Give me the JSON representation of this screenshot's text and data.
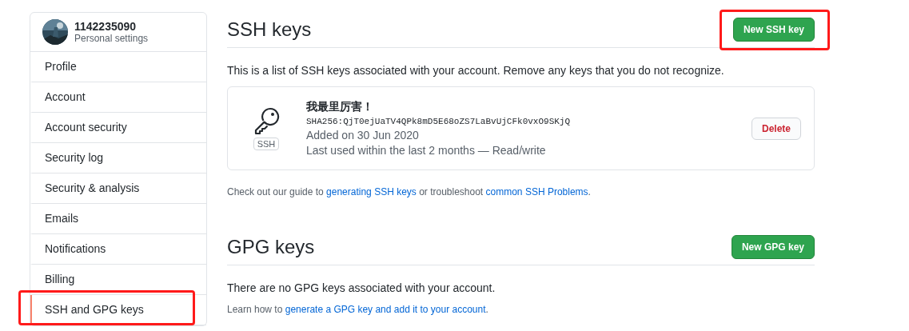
{
  "profile": {
    "username": "1142235090",
    "subtitle": "Personal settings"
  },
  "sidebar": {
    "items": [
      {
        "label": "Profile",
        "selected": false,
        "highlighted": false
      },
      {
        "label": "Account",
        "selected": false,
        "highlighted": false
      },
      {
        "label": "Account security",
        "selected": false,
        "highlighted": false
      },
      {
        "label": "Security log",
        "selected": false,
        "highlighted": false
      },
      {
        "label": "Security & analysis",
        "selected": false,
        "highlighted": false
      },
      {
        "label": "Emails",
        "selected": false,
        "highlighted": false
      },
      {
        "label": "Notifications",
        "selected": false,
        "highlighted": false
      },
      {
        "label": "Billing",
        "selected": false,
        "highlighted": false
      },
      {
        "label": "SSH and GPG keys",
        "selected": true,
        "highlighted": true
      }
    ]
  },
  "sections": [
    {
      "title": "SSH keys",
      "button": {
        "label": "New SSH key",
        "highlighted": true
      },
      "description": "This is a list of SSH keys associated with your account. Remove any keys that you do not recognize.",
      "keys": [
        {
          "name": "我最里厉害！",
          "fingerprint": "SHA256:QjT0ejUaTV4QPk8mD5E68oZS7LaBvUjCFk0vxO9SKjQ",
          "added": "Added on 30 Jun 2020",
          "last_used": "Last used within the last 2 months — Read/write",
          "badge": "SSH",
          "action": "Delete"
        }
      ],
      "footer": [
        {
          "text": "Check out our guide to ",
          "link": false
        },
        {
          "text": "generating SSH keys",
          "link": true
        },
        {
          "text": " or troubleshoot ",
          "link": false
        },
        {
          "text": "common SSH Problems",
          "link": true
        },
        {
          "text": ".",
          "link": false
        }
      ]
    },
    {
      "title": "GPG keys",
      "button": {
        "label": "New GPG key",
        "highlighted": false
      },
      "description": "There are no GPG keys associated with your account.",
      "footer": [
        {
          "text": "Learn how to ",
          "link": false
        },
        {
          "text": "generate a GPG key and add it to your account",
          "link": true
        },
        {
          "text": ".",
          "link": false
        }
      ]
    }
  ]
}
